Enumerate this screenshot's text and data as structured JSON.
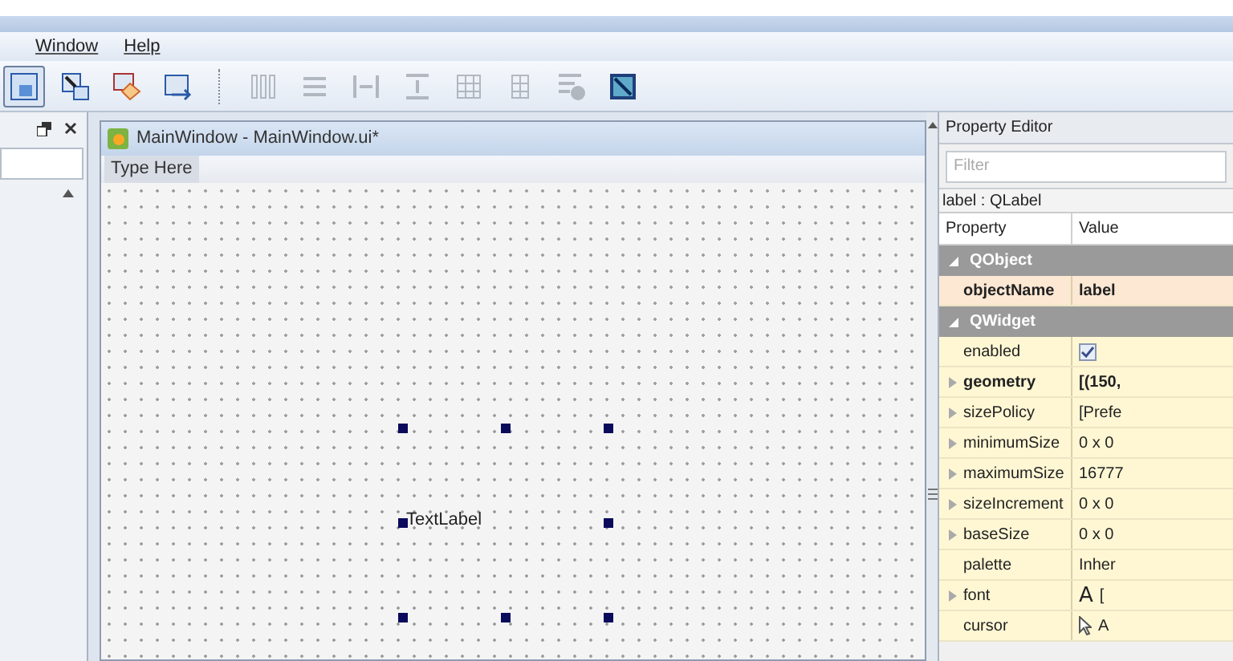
{
  "menu": [
    {
      "label": "Window"
    },
    {
      "label": "Help"
    }
  ],
  "toolbar": [
    {
      "kind": "widgets",
      "selected": true,
      "disabled": false
    },
    {
      "kind": "signals",
      "selected": false,
      "disabled": false
    },
    {
      "kind": "buddies",
      "selected": false,
      "disabled": false
    },
    {
      "kind": "taborder",
      "selected": false,
      "disabled": false
    },
    {
      "kind": "hbox",
      "selected": false,
      "disabled": true
    },
    {
      "kind": "vbox",
      "selected": false,
      "disabled": true
    },
    {
      "kind": "hsplit",
      "selected": false,
      "disabled": true
    },
    {
      "kind": "vsplit",
      "selected": false,
      "disabled": true
    },
    {
      "kind": "grid",
      "selected": false,
      "disabled": true
    },
    {
      "kind": "form",
      "selected": false,
      "disabled": true
    },
    {
      "kind": "break",
      "selected": false,
      "disabled": true
    },
    {
      "kind": "adjust",
      "selected": false,
      "disabled": false
    }
  ],
  "form_window": {
    "title": "MainWindow - MainWindow.ui*",
    "menu_placeholder": "Type Here",
    "label": {
      "text": "TextLabel",
      "selected": true
    }
  },
  "property_editor": {
    "title": "Property Editor",
    "filter": {
      "placeholder": "Filter"
    },
    "object": "label : QLabel",
    "columns": [
      "Property",
      "Value"
    ],
    "groups": [
      {
        "name": "QObject",
        "expanded": true,
        "color": "#fde8d4",
        "properties": [
          {
            "name": "objectName",
            "value": "label",
            "kind": "text",
            "modified": true,
            "expandable": false
          }
        ]
      },
      {
        "name": "QWidget",
        "expanded": true,
        "color": "#fff7d4",
        "properties": [
          {
            "name": "enabled",
            "kind": "checkbox",
            "checked": true,
            "modified": false,
            "expandable": false
          },
          {
            "name": "geometry",
            "value": "[(150,",
            "kind": "text",
            "modified": true,
            "expandable": true
          },
          {
            "name": "sizePolicy",
            "value": "[Prefe",
            "kind": "text",
            "modified": false,
            "expandable": true
          },
          {
            "name": "minimumSize",
            "value": "0 x 0",
            "kind": "text",
            "modified": false,
            "expandable": true
          },
          {
            "name": "maximumSize",
            "value": "16777",
            "kind": "text",
            "modified": false,
            "expandable": true
          },
          {
            "name": "sizeIncrement",
            "value": "0 x 0",
            "kind": "text",
            "modified": false,
            "expandable": true
          },
          {
            "name": "baseSize",
            "value": "0 x 0",
            "kind": "text",
            "modified": false,
            "expandable": true
          },
          {
            "name": "palette",
            "value": "Inher",
            "kind": "text",
            "modified": false,
            "expandable": false
          },
          {
            "name": "font",
            "preview": "A",
            "value": "[",
            "kind": "font",
            "modified": false,
            "expandable": true
          },
          {
            "name": "cursor",
            "value": "A",
            "kind": "cursor",
            "modified": false,
            "expandable": false
          }
        ]
      }
    ]
  }
}
